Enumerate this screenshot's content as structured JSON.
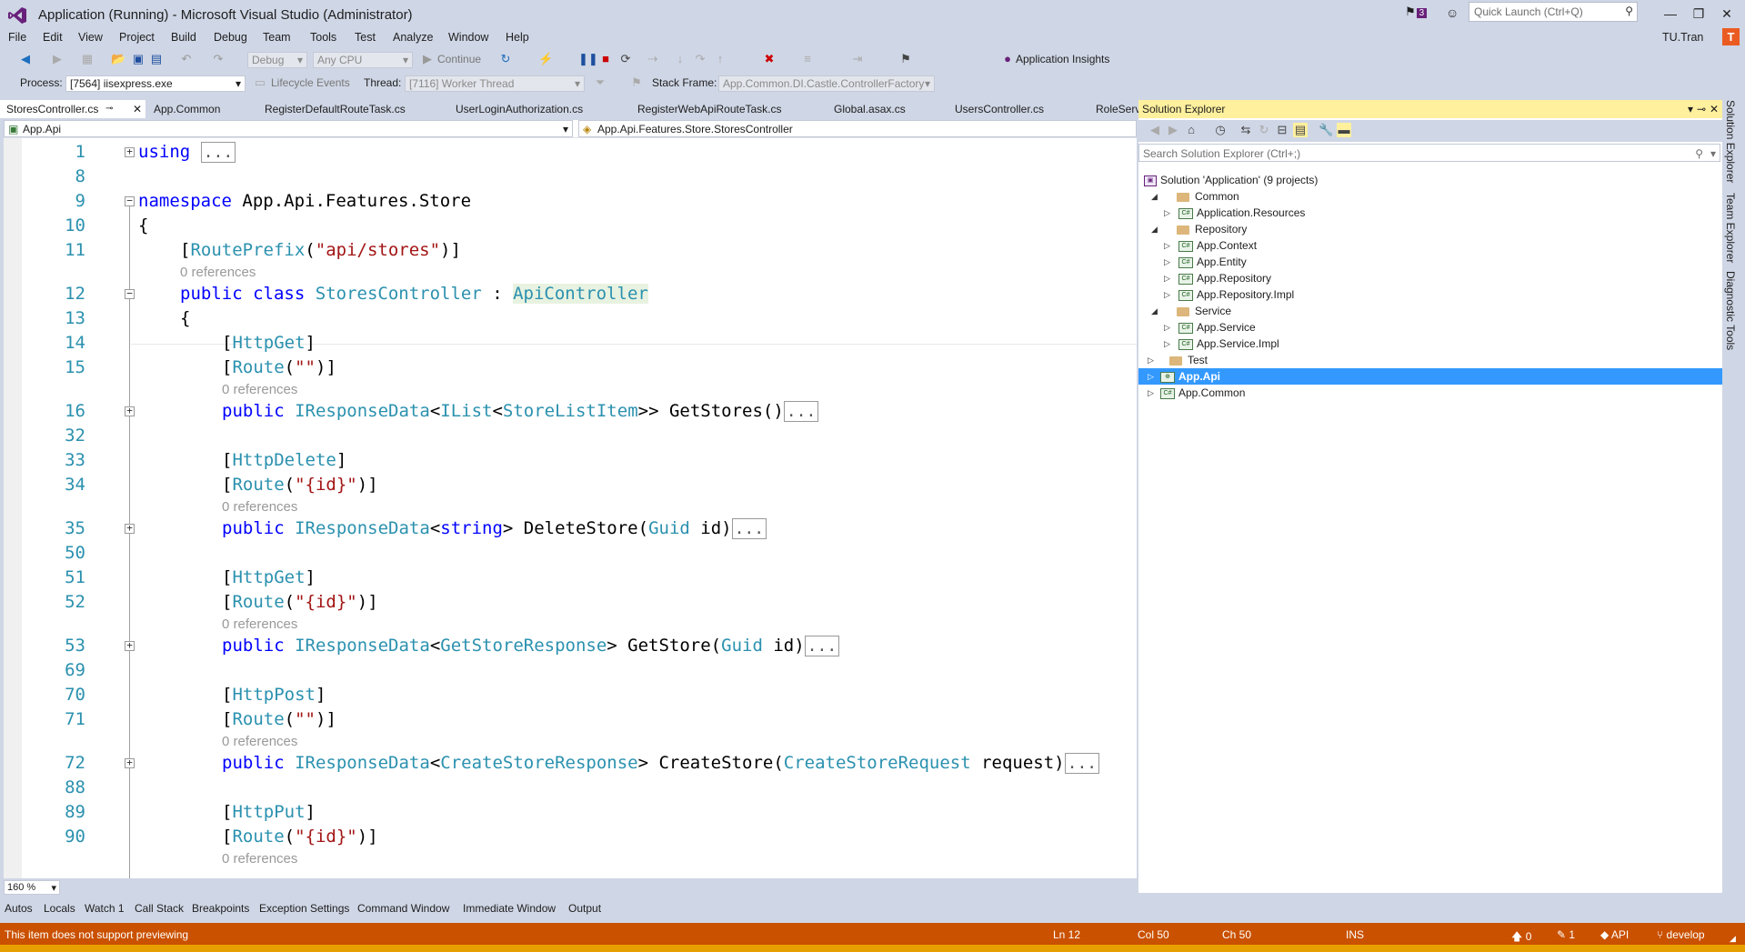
{
  "window": {
    "title": "Application (Running) - Microsoft Visual Studio (Administrator)",
    "notification_count": "3",
    "quick_launch_placeholder": "Quick Launch (Ctrl+Q)",
    "user": "TU.Tran",
    "user_initial": "T"
  },
  "menu": [
    "File",
    "Edit",
    "View",
    "Project",
    "Build",
    "Debug",
    "Team",
    "Tools",
    "Test",
    "Analyze",
    "Window",
    "Help"
  ],
  "toolbar": {
    "config": "Debug",
    "platform": "Any CPU",
    "continue_label": "Continue",
    "app_insights": "Application Insights"
  },
  "debug_location": {
    "process_label": "Process:",
    "process_value": "[7564] iisexpress.exe",
    "lifecycle_label": "Lifecycle Events",
    "thread_label": "Thread:",
    "thread_value": "[7116] Worker Thread",
    "stack_frame_label": "Stack Frame:",
    "stack_frame_value": "App.Common.DI.Castle.ControllerFactory"
  },
  "doc_tabs": [
    "StoresController.cs",
    "App.Common",
    "RegisterDefaultRouteTask.cs",
    "UserLoginAuthorization.cs",
    "RegisterWebApiRouteTask.cs",
    "Global.asax.cs",
    "UsersController.cs",
    "RoleServ"
  ],
  "nav": {
    "project": "App.Api",
    "type": "App.Api.Features.Store.StoresController"
  },
  "editor": {
    "zoom": "160 %",
    "refs_text": "0 references",
    "line_numbers": [
      "1",
      "8",
      "9",
      "10",
      "11",
      "12",
      "13",
      "14",
      "15",
      "16",
      "32",
      "33",
      "34",
      "35",
      "50",
      "51",
      "52",
      "53",
      "69",
      "70",
      "71",
      "72",
      "88",
      "89",
      "90"
    ],
    "using_kw": "using",
    "ellipsis": "...",
    "namespace_kw": "namespace",
    "namespace_name": " App.Api.Features.Store",
    "brace_open": "{",
    "route_prefix": "RoutePrefix",
    "route_prefix_arg": "\"api/stores\"",
    "public_kw": "public",
    "class_kw": "class",
    "class_name": "StoresController",
    "colon": " : ",
    "base_class": "ApiController",
    "http_get": "HttpGet",
    "http_delete": "HttpDelete",
    "http_post": "HttpPost",
    "http_put": "HttpPut",
    "route": "Route",
    "route_empty": "\"\"",
    "route_id": "\"{id}\"",
    "iresponse": "IResponseData",
    "ilist": "IList",
    "store_list_item": "StoreListItem",
    "get_stores": ">> GetStores()",
    "string_kw": "string",
    "delete_store": "> DeleteStore(",
    "guid": "Guid",
    "id_param": " id)",
    "get_store_response": "GetStoreResponse",
    "get_store": "> GetStore(",
    "create_store_response": "CreateStoreResponse",
    "create_store": "> CreateStore(",
    "create_store_request": "CreateStoreRequest",
    "request_param": " request)"
  },
  "solution_explorer": {
    "title": "Solution Explorer",
    "search_placeholder": "Search Solution Explorer (Ctrl+;)",
    "solution": "Solution 'Application' (9 projects)",
    "items": [
      {
        "label": "Common",
        "kind": "folder",
        "level": 1
      },
      {
        "label": "Application.Resources",
        "kind": "project",
        "level": 2
      },
      {
        "label": "Repository",
        "kind": "folder",
        "level": 1
      },
      {
        "label": "App.Context",
        "kind": "project",
        "level": 2
      },
      {
        "label": "App.Entity",
        "kind": "project",
        "level": 2
      },
      {
        "label": "App.Repository",
        "kind": "project",
        "level": 2
      },
      {
        "label": "App.Repository.Impl",
        "kind": "project",
        "level": 2
      },
      {
        "label": "Service",
        "kind": "folder",
        "level": 1
      },
      {
        "label": "App.Service",
        "kind": "project",
        "level": 2
      },
      {
        "label": "App.Service.Impl",
        "kind": "project",
        "level": 2
      },
      {
        "label": "Test",
        "kind": "folder",
        "level": 1
      },
      {
        "label": "App.Api",
        "kind": "project",
        "level": 1,
        "selected": true
      },
      {
        "label": "App.Common",
        "kind": "project",
        "level": 1
      }
    ]
  },
  "side_tabs": [
    "Solution Explorer",
    "Team Explorer",
    "Diagnostic Tools"
  ],
  "bottom_tabs": [
    "Autos",
    "Locals",
    "Watch 1",
    "Call Stack",
    "Breakpoints",
    "Exception Settings",
    "Command Window",
    "Immediate Window",
    "Output"
  ],
  "status": {
    "message": "This item does not support previewing",
    "ln": "Ln 12",
    "col": "Col 50",
    "ch": "Ch 50",
    "mode": "INS",
    "up_count": "0",
    "pencil_count": "1",
    "repo": "API",
    "branch": "develop"
  },
  "colors": {
    "accent": "#68217a",
    "status_bar": "#ca5100",
    "selection": "#3399ff",
    "keyword": "#0000ff",
    "type": "#2b91af",
    "string": "#a31515"
  }
}
